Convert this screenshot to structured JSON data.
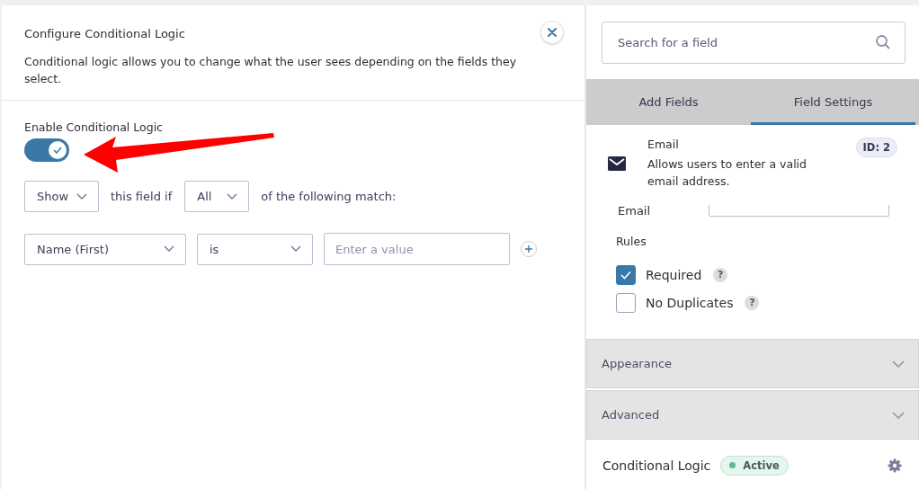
{
  "modal": {
    "title": "Configure Conditional Logic",
    "description": "Conditional logic allows you to change what the user sees depending on the fields they select.",
    "enable_label": "Enable Conditional Logic",
    "enable_on": true,
    "rule_line": {
      "action": "Show",
      "text_1": "this field if",
      "match": "All",
      "text_2": "of the following match:"
    },
    "condition": {
      "field": "Name (First)",
      "operator": "is",
      "value_placeholder": "Enter a value"
    }
  },
  "sidebar": {
    "search": {
      "placeholder": "Search for a field"
    },
    "tabs": [
      {
        "label": "Add Fields",
        "selected": false
      },
      {
        "label": "Field Settings",
        "selected": true
      }
    ],
    "field_card": {
      "name": "Email",
      "description": "Allows users to enter a valid email address.",
      "badge": "ID: 2"
    },
    "hidden_label": "Email",
    "rules_title": "Rules",
    "rules": [
      {
        "label": "Required",
        "checked": true,
        "help": "?"
      },
      {
        "label": "No Duplicates",
        "checked": false,
        "help": "?"
      }
    ],
    "sections": [
      {
        "label": "Appearance",
        "expanded": false
      },
      {
        "label": "Advanced",
        "expanded": false
      }
    ],
    "conditional_logic": {
      "label": "Conditional Logic",
      "status": "Active",
      "color": "#5fb98e"
    }
  }
}
